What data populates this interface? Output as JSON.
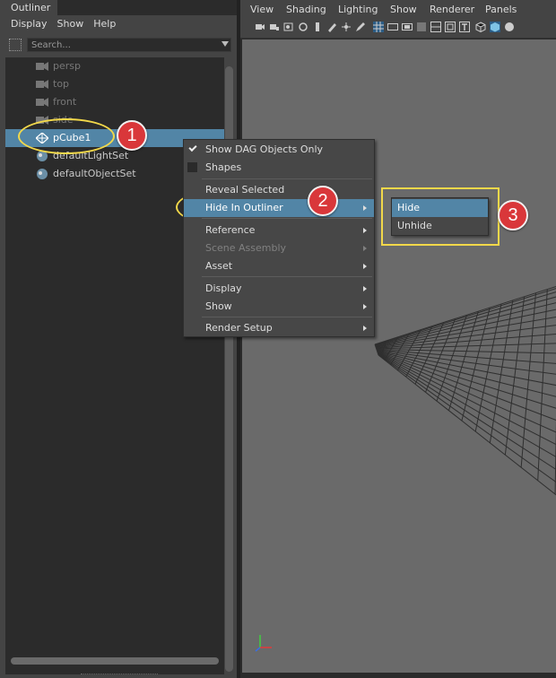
{
  "outliner": {
    "tab_label": "Outliner",
    "menu": [
      "Display",
      "Show",
      "Help"
    ],
    "search_placeholder": "Search...",
    "items": [
      {
        "label": "persp",
        "icon": "camera-icon",
        "state": "dim"
      },
      {
        "label": "top",
        "icon": "camera-icon",
        "state": "dim"
      },
      {
        "label": "front",
        "icon": "camera-icon",
        "state": "dim"
      },
      {
        "label": "side",
        "icon": "camera-icon",
        "state": "dim"
      },
      {
        "label": "pCube1",
        "icon": "mesh-icon",
        "state": "selected"
      },
      {
        "label": "defaultLightSet",
        "icon": "set-icon",
        "state": "normal"
      },
      {
        "label": "defaultObjectSet",
        "icon": "set-icon",
        "state": "normal"
      }
    ]
  },
  "viewport": {
    "menu": [
      "View",
      "Shading",
      "Lighting",
      "Show",
      "Renderer",
      "Panels"
    ]
  },
  "context_menu": {
    "items": [
      {
        "label": "Show DAG Objects Only",
        "type": "check",
        "checked": true
      },
      {
        "label": "Shapes",
        "type": "check",
        "checked": false
      },
      {
        "label": "Reveal Selected"
      },
      {
        "label": "Hide In Outliner",
        "submenu": true,
        "highlighted": true
      },
      {
        "label": "Reference",
        "submenu": true
      },
      {
        "label": "Scene Assembly",
        "submenu": true,
        "disabled": true
      },
      {
        "label": "Asset",
        "submenu": true
      },
      {
        "label": "Display",
        "submenu": true
      },
      {
        "label": "Show",
        "submenu": true
      },
      {
        "label": "Render Setup",
        "submenu": true
      }
    ]
  },
  "submenu": {
    "items": [
      {
        "label": "Hide",
        "highlighted": true
      },
      {
        "label": "Unhide"
      }
    ]
  },
  "annotations": {
    "steps": [
      "1",
      "2",
      "3"
    ],
    "color": "#f2d84a",
    "badge_color": "#d9373a"
  },
  "colors": {
    "selection": "#5285a6",
    "panel": "#444444",
    "viewport_bg": "#6a6a6a",
    "grid": "#2f2f2f"
  }
}
